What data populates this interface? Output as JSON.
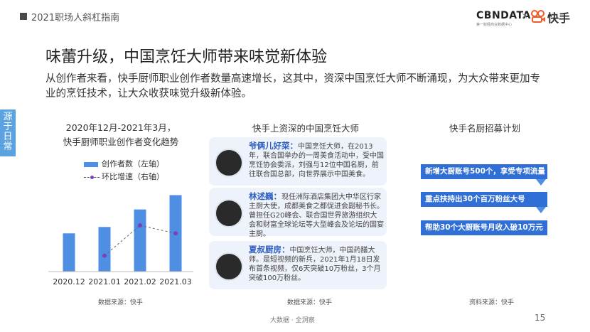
{
  "header": {
    "section": "2021职场人斜杠指南"
  },
  "logos": {
    "cbn": "CBNDATA",
    "cbn_sub": "第一财经商业数据中心",
    "x": "×",
    "kuaishou": "快手"
  },
  "title": "味蕾升级，中国烹饪大师带来味觉新体验",
  "lead": "从创作者来看，快手厨师职业创作者数量高速增长，这其中，资深中国烹饪大师不断涌现，为大众带来更加专业的烹饪技术，让大众收获味觉升级新体验。",
  "side_tab": "源于日常",
  "left_panel": {
    "title_line1": "2020年12月-2021年3月，",
    "title_line2": "快手厨师职业创作者变化趋势",
    "legend_bar": "创作者数（左轴）",
    "legend_line": "环比增速（右轴）",
    "source": "数据来源：快手"
  },
  "chart_data": {
    "type": "bar",
    "categories": [
      "2020.12",
      "2021.01",
      "2021.02",
      "2021.03"
    ],
    "series": [
      {
        "name": "创作者数（左轴）",
        "type": "bar",
        "values": [
          48,
          56,
          78,
          96
        ]
      },
      {
        "name": "环比增速（右轴）",
        "type": "line",
        "values": [
          null,
          20,
          58,
          48
        ]
      }
    ],
    "bar_color": "#4f8fe3",
    "line_color": "#7b3fc0",
    "ylim": [
      0,
      100
    ],
    "grid": false
  },
  "mid_panel": {
    "title": "快手上资深的中国烹饪大师",
    "cards": [
      {
        "name": "爷俩儿好菜：",
        "desc": "中国烹饪大师，在2013年，联合国举办的一周美食活动中，受中国烹饪协会委派，刘强与12位中国名厨，前往联合国总部，向世界展示中国美食。"
      },
      {
        "name": "林述巍：",
        "desc": "现任洲际酒店集团大中华区行家主厨大使，成都美食之都促进会副秘书长。曾担任G20峰会、联合国世界旅游组织大会和财富全球论坛等大型峰会及论坛的国宴主厨。"
      },
      {
        "name": "夏叔厨房：",
        "desc": "中国烹饪大师，中国药膳大师。是短视频的新兵，2021年1月18日发布首条视频，仅6天突破10万粉丝，3个月突破100万粉丝。"
      }
    ],
    "source": "数据来源：快手"
  },
  "right_panel": {
    "title": "快手名厨招募计划",
    "items": [
      "新增大厨账号500个，享受专项流量扶持",
      "重点扶持出30个百万粉丝大号",
      "帮助30个大厨账号月收入破10万元"
    ],
    "source": "资料来源：快手"
  },
  "footer": {
    "brand": "大数据 · 全洞察",
    "page": "15"
  }
}
